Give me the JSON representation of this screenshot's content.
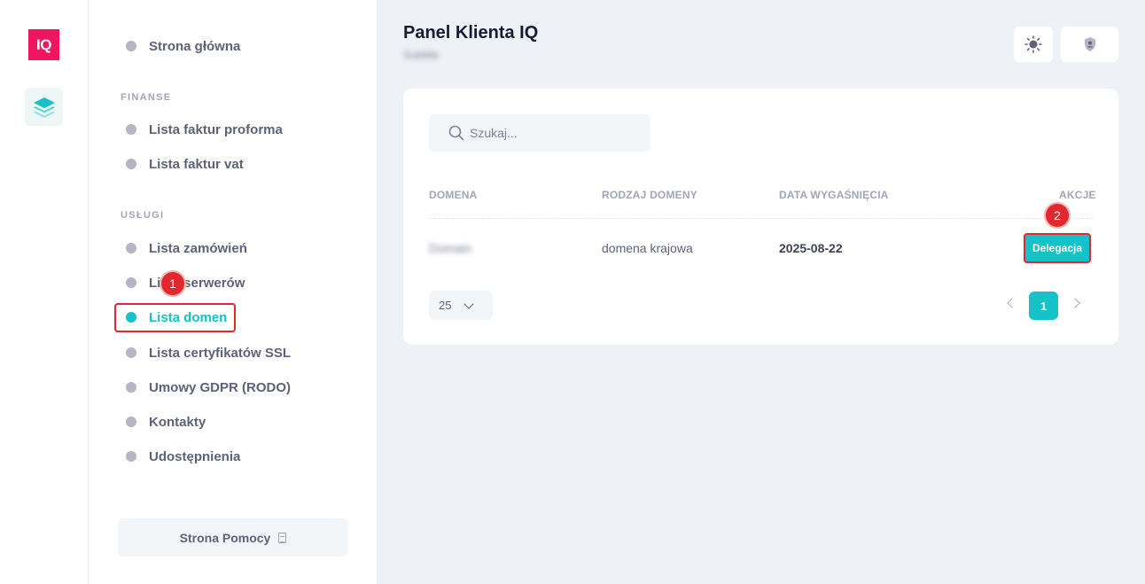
{
  "rail": {
    "logo_text": "IQ"
  },
  "sidebar": {
    "home": "Strona główna",
    "finance_title": "FINANSE",
    "finance_items": [
      "Lista faktur proforma",
      "Lista faktur vat"
    ],
    "services_title": "USŁUGI",
    "services_items": [
      "Lista zamówień",
      "Lista serwerów",
      "Lista domen",
      "Lista certyfikatów SSL",
      "Umowy GDPR (RODO)",
      "Kontakty",
      "Udostępnienia"
    ],
    "active_item": "Lista domen",
    "help_button": "Strona Pomocy"
  },
  "markers": {
    "m1": "1",
    "m2": "2"
  },
  "header": {
    "title": "Panel Klienta IQ",
    "subtitle_blurred": "Subtitle",
    "icons": [
      "sun-icon",
      "shield-user-icon"
    ]
  },
  "table": {
    "search_placeholder": "Szukaj...",
    "columns": [
      "DOMENA",
      "RODZAJ DOMENY",
      "DATA WYGAŚNIĘCIA",
      "AKCJE"
    ],
    "rows": [
      {
        "domain": "Domain",
        "type": "domena krajowa",
        "expires": "2025-08-22",
        "action": "Delegacja"
      }
    ],
    "per_page": "25",
    "current_page": "1"
  },
  "colors": {
    "accent": "#14c2c7",
    "brand": "#f0155e",
    "annotation": "#e0282e"
  }
}
